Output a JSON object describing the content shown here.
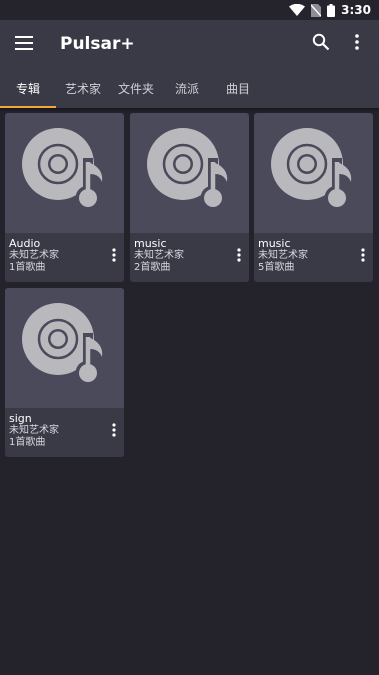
{
  "status": {
    "time": "3:30"
  },
  "appbar": {
    "title": "Pulsar+"
  },
  "tabs": [
    {
      "label": "专辑",
      "active": true
    },
    {
      "label": "艺术家",
      "active": false
    },
    {
      "label": "文件夹",
      "active": false
    },
    {
      "label": "流派",
      "active": false
    },
    {
      "label": "曲目",
      "active": false
    }
  ],
  "albums": [
    {
      "name": "Audio",
      "artist": "未知艺术家",
      "count": "1首歌曲"
    },
    {
      "name": "music",
      "artist": "未知艺术家",
      "count": "2首歌曲"
    },
    {
      "name": "music",
      "artist": "未知艺术家",
      "count": "5首歌曲"
    },
    {
      "name": "sign",
      "artist": "未知艺术家",
      "count": "1首歌曲"
    }
  ],
  "colors": {
    "accent": "#f2a73b",
    "appbar": "#3a3a47",
    "background": "#24232b"
  }
}
